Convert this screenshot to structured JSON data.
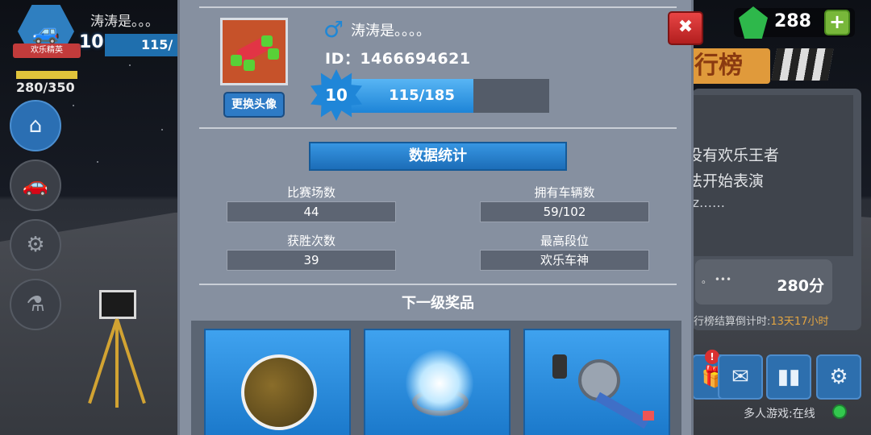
{
  "background": {
    "player_name": "涛涛是。。。",
    "rank_ribbon": "欢乐精英",
    "level": "10",
    "xp": "115/",
    "fuel": "280/350",
    "side_buttons": [
      {
        "name": "home-icon",
        "glyph": "⌂"
      },
      {
        "name": "car-icon",
        "glyph": "🚗"
      },
      {
        "name": "part-icon",
        "glyph": "⚙"
      },
      {
        "name": "flask-icon",
        "glyph": "⚗"
      }
    ]
  },
  "currency": {
    "gems": "288",
    "add": "+"
  },
  "leaderboard": {
    "tab_label": "行榜",
    "line1": "没有欢乐王者",
    "line2": "法开始表演",
    "line3": "rz……",
    "dots": "。 •••",
    "score": "280分",
    "countdown_label": "行榜结算倒计时:",
    "countdown_value": "13天17小时",
    "badge": "!",
    "online_label": "多人游戏:在线"
  },
  "profile": {
    "name": "涛涛是。。。。",
    "id": "ID：1466694621",
    "change_avatar": "更换头像",
    "level": "10",
    "xp_text": "115/185",
    "xp_fraction": 0.622
  },
  "stats": {
    "title": "数据统计",
    "items": [
      {
        "label": "比赛场数",
        "value": "44"
      },
      {
        "label": "拥有车辆数",
        "value": "59/102"
      },
      {
        "label": "获胜次数",
        "value": "39"
      },
      {
        "label": "最高段位",
        "value": "欢乐车神"
      }
    ]
  },
  "rewards": {
    "title": "下一级奖品"
  },
  "close": "✖"
}
